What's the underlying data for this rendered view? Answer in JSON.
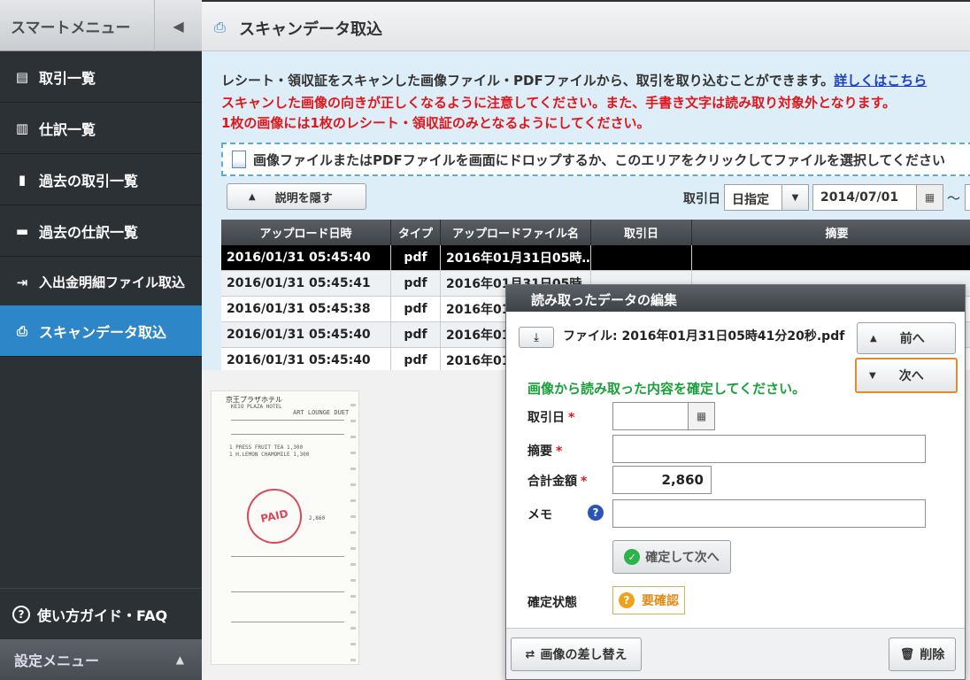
{
  "sidebar": {
    "title": "スマートメニュー",
    "collapse_icon": "◀",
    "items": [
      {
        "label": "取引一覧",
        "icon": "list-icon",
        "glyph": "▤"
      },
      {
        "label": "仕訳一覧",
        "icon": "book-icon",
        "glyph": "▥"
      },
      {
        "label": "過去の取引一覧",
        "icon": "doc-icon",
        "glyph": "▮"
      },
      {
        "label": "過去の仕訳一覧",
        "icon": "doc-icon",
        "glyph": "▬"
      },
      {
        "label": "入出金明細ファイル取込",
        "icon": "import-icon",
        "glyph": "⇥"
      },
      {
        "label": "スキャンデータ取込",
        "icon": "scanner-icon",
        "glyph": "⎙"
      }
    ],
    "guide_label": "使い方ガイド・FAQ",
    "settings_label": "設定メニュー",
    "settings_caret": "▲"
  },
  "header": {
    "title": "スキャンデータ取込",
    "icon": "⎙"
  },
  "info": {
    "line1": "レシート・領収証をスキャンした画像ファイル・PDFファイルから、取引を取り込むことができます。",
    "link": "詳しくはこちら",
    "line2": "スキャンした画像の向きが正しくなるように注意してください。また、手書き文字は読み取り対象外となります。",
    "line3": "1枚の画像には1枚のレシート・領収証のみとなるようにしてください。"
  },
  "dropzone": {
    "text": "画像ファイルまたはPDFファイルを画面にドロップするか、このエリアをクリックしてファイルを選択してください"
  },
  "toolbar": {
    "hide_label": "説明を隠す",
    "date_label": "取引日",
    "date_mode": "日指定",
    "date_from": "2014/07/01",
    "tilde": "〜"
  },
  "table": {
    "headers": [
      "アップロード日時",
      "タイプ",
      "アップロードファイル名",
      "取引日",
      "摘要"
    ],
    "rows": [
      {
        "uploaded": "2016/01/31 05:45:40",
        "type": "pdf",
        "file": "2016年01月31日05時…",
        "date": "",
        "memo": ""
      },
      {
        "uploaded": "2016/01/31 05:45:41",
        "type": "pdf",
        "file": "2016年01月31日05時…",
        "date": "",
        "memo": ""
      },
      {
        "uploaded": "2016/01/31 05:45:38",
        "type": "pdf",
        "file": "2016年01",
        "date": "",
        "memo": ""
      },
      {
        "uploaded": "2016/01/31 05:45:40",
        "type": "pdf",
        "file": "2016年01",
        "date": "",
        "memo": ""
      },
      {
        "uploaded": "2016/01/31 05:45:40",
        "type": "pdf",
        "file": "2016年01",
        "date": "",
        "memo": ""
      }
    ]
  },
  "receipt": {
    "hotel": "京王プラザホテル",
    "hotel_en": "KEIO PLAZA HOTEL",
    "venue": "ART LOUNGE DUET",
    "items": [
      "1  PRESS FRUIT TEA    1,300",
      "1  H.LEMON CHAMOMILE   1,300"
    ],
    "total": "2,860",
    "stamp": "PAID"
  },
  "dialog": {
    "title": "読み取ったデータの編集",
    "file_label": "ファイル: 2016年01月31日05時41分20秒.pdf",
    "prev_label": "前へ",
    "next_label": "次へ",
    "confirm_msg": "画像から読み取った内容を確定してください。",
    "fields": {
      "date_label": "取引日",
      "memo_label": "摘要",
      "amount_label": "合計金額",
      "amount_value": "2,860",
      "note_label": "メモ",
      "required_mark": "*"
    },
    "confirm_button": "確定して次へ",
    "status_label": "確定状態",
    "status_value": "要確認",
    "replace_label": "画像の差し替え",
    "delete_label": "削除"
  },
  "colors": {
    "accent": "#2d86c7",
    "warning": "#e0161a",
    "success": "#1aa03a",
    "next_border": "#e48a2a"
  }
}
